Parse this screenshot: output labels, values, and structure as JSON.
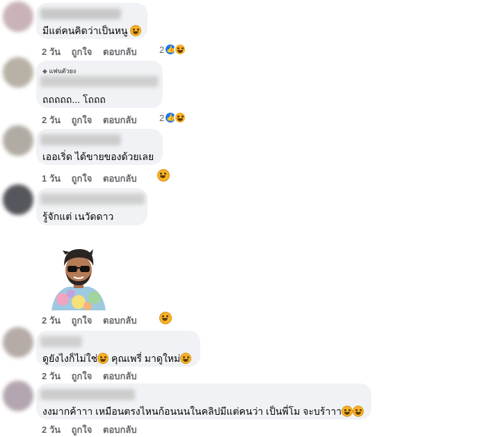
{
  "comments": [
    {
      "text": "มีแต่คนคิดว่าเป็นหนู",
      "time": "2 วัน",
      "like": "ถูกใจ",
      "reply": "ตอบกลับ",
      "reactions": "2"
    },
    {
      "badge": "แฟนตัวยง",
      "text": "ถถถถถ... โถถถ",
      "time": "2 วัน",
      "like": "ถูกใจ",
      "reply": "ตอบกลับ",
      "reactions": "2"
    },
    {
      "text": "เออเริ่ด ได้ขายของด้วยเลย",
      "time": "1 วัน",
      "like": "ถูกใจ",
      "reply": "ตอบกลับ"
    },
    {
      "text": "รู้จักแต่ เนวัดดาว"
    },
    {
      "time": "2 วัน",
      "like": "ถูกใจ",
      "reply": "ตอบกลับ"
    },
    {
      "text_a": "ดูยังไงก็ไม่ใช่",
      "text_b": "คุณเพรี่ มาดูใหม่",
      "time": "2 วัน",
      "like": "ถูกใจ",
      "reply": "ตอบกลับ"
    },
    {
      "text": "งงมากค้าาา เหมือนตรงไหนก้อนนนในคลิปมีแต่คนว่า เป็นพี่โม จะบร้าาา",
      "time": "2 วัน",
      "like": "ถูกใจ",
      "reply": "ตอบกลับ"
    }
  ],
  "icons": {
    "like": "like-icon",
    "laugh": "laugh-emoji",
    "diamond": "diamond-icon"
  },
  "colors": {
    "bubble": "#f0f2f5",
    "meta": "#65676b",
    "like_blue": "#1877f2"
  }
}
